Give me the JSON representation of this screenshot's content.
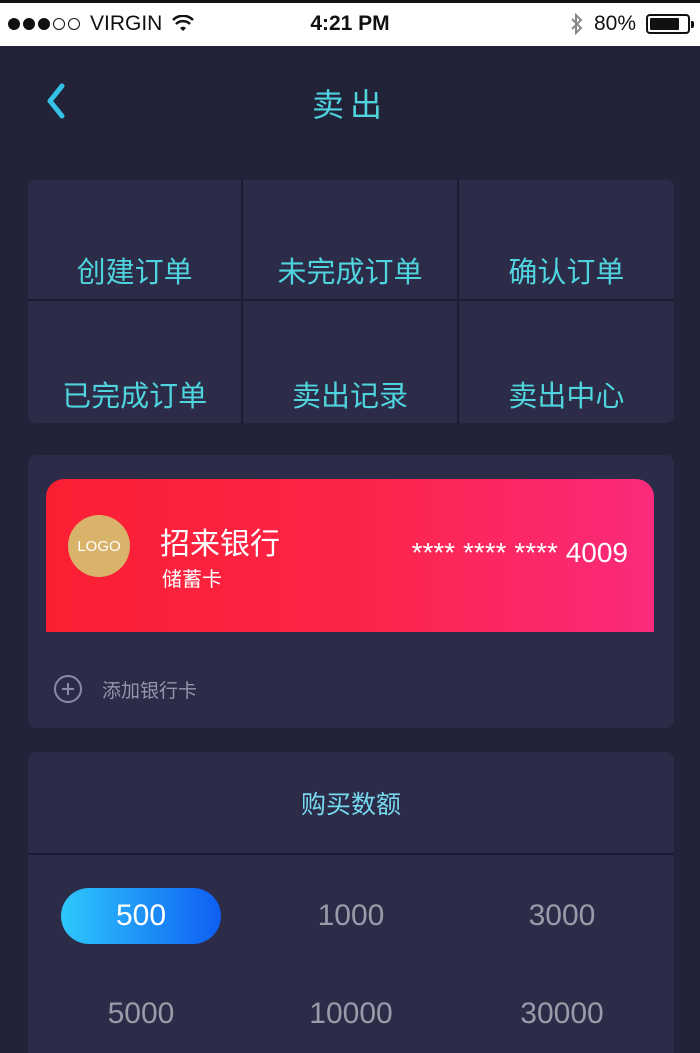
{
  "status_bar": {
    "carrier": "VIRGIN",
    "time": "4:21 PM",
    "battery": "80%",
    "battery_level": 0.8
  },
  "nav": {
    "title": "卖出"
  },
  "menu": [
    {
      "label": "创建订单"
    },
    {
      "label": "未完成订单"
    },
    {
      "label": "确认订单"
    },
    {
      "label": "已完成订单"
    },
    {
      "label": "卖出记录"
    },
    {
      "label": "卖出中心"
    }
  ],
  "bank_card": {
    "logo_text": "LOGO",
    "bank_name": "招来银行",
    "card_type": "储蓄卡",
    "card_number": "**** **** **** 4009",
    "add_card_label": "添加银行卡"
  },
  "amount": {
    "title": "购买数额",
    "options": [
      "500",
      "1000",
      "3000",
      "5000",
      "10000",
      "30000"
    ],
    "selected": "500"
  },
  "colors": {
    "background": "#222238",
    "panel": "#2c2b48",
    "accent": "#4fd3dd",
    "card_gradient_start": "#fb1f33",
    "card_gradient_end": "#fb2a7c",
    "selected_gradient_start": "#2ec8fc",
    "selected_gradient_end": "#0f5ef2"
  }
}
